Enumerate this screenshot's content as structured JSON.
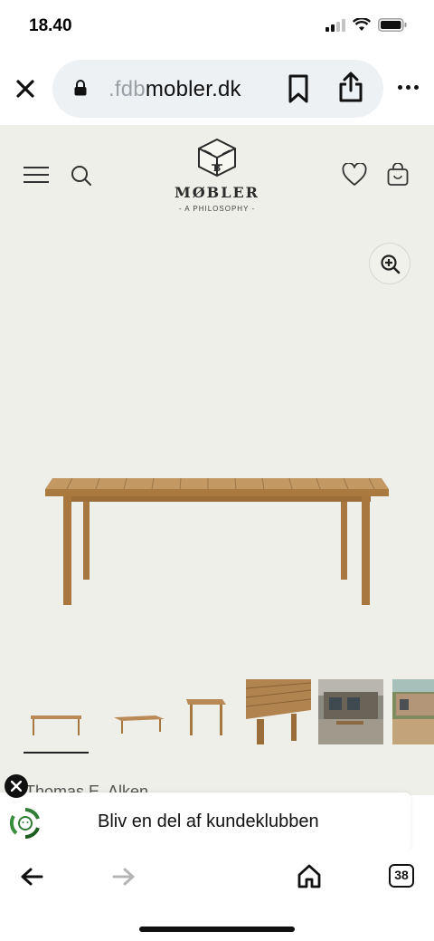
{
  "status": {
    "time": "18.40"
  },
  "browser": {
    "url_dim": ".fdb",
    "url_main": "mobler.dk",
    "tab_count": "38"
  },
  "site": {
    "logo_name": "MØBLER",
    "logo_tag": "- A PHILOSOPHY -",
    "logo_letter": "B"
  },
  "product": {
    "designer_partial": "Thomas E. Alken"
  },
  "banner": {
    "text": "Bliv en del af kundeklubben"
  },
  "colors": {
    "site_bg": "#efefe9",
    "wood": "#b98a57"
  }
}
